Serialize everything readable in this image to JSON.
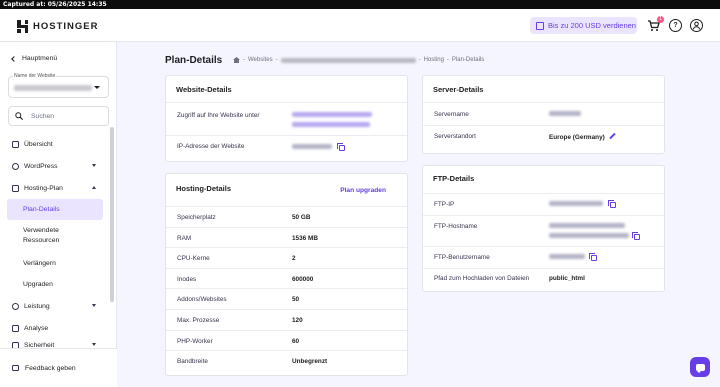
{
  "capture": {
    "label": "Captured at: 05/26/2025 14:35"
  },
  "header": {
    "brand": "HOSTINGER",
    "promo": "Bis zu 200 USD verdienen",
    "cart_badge": "1",
    "help_glyph": "?"
  },
  "sidebar": {
    "back_label": "Hauptmenü",
    "website_select_label": "Name der Website",
    "search_placeholder": "Suchen",
    "items": [
      {
        "label": "Übersicht",
        "icon": "overview-icon"
      },
      {
        "label": "WordPress",
        "icon": "wordpress-icon"
      },
      {
        "label": "Hosting-Plan",
        "icon": "hosting-plan-icon"
      },
      {
        "label": "Plan-Details"
      },
      {
        "label": "Verwendete Ressourcen"
      },
      {
        "label": "Verlängern"
      },
      {
        "label": "Upgraden"
      },
      {
        "label": "Leistung",
        "icon": "performance-icon"
      },
      {
        "label": "Analyse",
        "icon": "analytics-icon"
      },
      {
        "label": "Sicherheit",
        "icon": "security-icon"
      }
    ],
    "feedback": "Feedback geben"
  },
  "page": {
    "title": "Plan-Details",
    "breadcrumb": {
      "websites": "Websites",
      "hosting": "Hosting",
      "current": "Plan-Details"
    }
  },
  "website_details": {
    "title": "Website-Details",
    "access_label": "Zugriff auf Ihre Website unter",
    "ip_label": "IP-Adresse der Website"
  },
  "hosting_details": {
    "title": "Hosting-Details",
    "upgrade_label": "Plan upgraden",
    "rows": [
      {
        "key": "Speicherplatz",
        "value": "50 GB"
      },
      {
        "key": "RAM",
        "value": "1536 MB"
      },
      {
        "key": "CPU-Kerne",
        "value": "2"
      },
      {
        "key": "Inodes",
        "value": "600000"
      },
      {
        "key": "Addons/Websites",
        "value": "50"
      },
      {
        "key": "Max. Prozesse",
        "value": "120"
      },
      {
        "key": "PHP-Worker",
        "value": "60"
      },
      {
        "key": "Bandbreite",
        "value": "Unbegrenzt"
      }
    ]
  },
  "server_details": {
    "title": "Server-Details",
    "name_label": "Servername",
    "location_label": "Serverstandort",
    "location_value": "Europe (Germany)"
  },
  "ftp_details": {
    "title": "FTP-Details",
    "ip_label": "FTP-IP",
    "host_label": "FTP-Hostname",
    "user_label": "FTP-Benutzername",
    "path_label": "Pfad zum Hochladen von Dateien",
    "path_value": "public_html"
  },
  "colors": {
    "accent": "#673de6",
    "accent_light": "#ebe4ff",
    "badge": "#fc5185",
    "bg": "#f4f5ff"
  }
}
